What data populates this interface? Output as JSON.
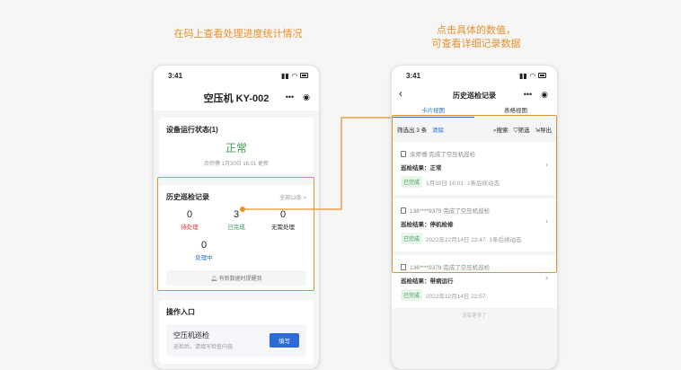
{
  "captions": {
    "left": "在码上查看处理进度统计情况",
    "right_line1": "点击具体的数值，",
    "right_line2": "可查看详细记录数据"
  },
  "left_phone": {
    "time": "3:41",
    "title": "空压机 KY-002",
    "status_card": {
      "title": "设备运行状态(1)",
      "value": "正常",
      "updated": "余师傅 1月30日 16:01 更新"
    },
    "history_card": {
      "title": "历史巡检记录",
      "all_link": "全部13条 >",
      "stats": [
        {
          "value": "0",
          "label": "待处理",
          "color": "#e03c3c"
        },
        {
          "value": "3",
          "label": "已完成",
          "color": "#3c9c52"
        },
        {
          "value": "0",
          "label": "无需处理",
          "color": "#333333"
        },
        {
          "value": "0",
          "label": "处理中",
          "color": "#2a6fd6"
        }
      ],
      "notice": "有新数据时提醒我"
    },
    "ops": {
      "title": "操作入口",
      "item_title": "空压机巡检",
      "item_sub": "巡检后，请填写检查内容",
      "button": "填写"
    }
  },
  "right_phone": {
    "time": "3:41",
    "title": "历史巡检记录",
    "tabs": [
      "卡片视图",
      "表格视图"
    ],
    "filter_summary": "筛选出 3 条",
    "clear": "清除",
    "search": "搜索",
    "filter": "筛选",
    "export": "导出",
    "records": [
      {
        "head": "余师傅  完成了空压机巡检",
        "result_label": "巡检结果：",
        "result": "正常",
        "badge": "已完成",
        "time": "1月30日 16:01",
        "note": "1条后续动态"
      },
      {
        "head": "136****9379  完成了空压机巡检",
        "result_label": "巡检结果：",
        "result": "停机检修",
        "badge": "已完成",
        "time": "2022年12月14日 23:47",
        "note": "1条后续动态"
      },
      {
        "head": "136****9379  完成了空压机巡检",
        "result_label": "巡检结果：",
        "result": "带病运行",
        "badge": "已完成",
        "time": "2022年12月14日 22:57",
        "note": ""
      }
    ],
    "end_text": "没有更多了"
  },
  "colors": {
    "accent": "#e8902a",
    "green": "#3c9c52",
    "blue": "#2a6fd6",
    "red": "#e03c3c"
  }
}
